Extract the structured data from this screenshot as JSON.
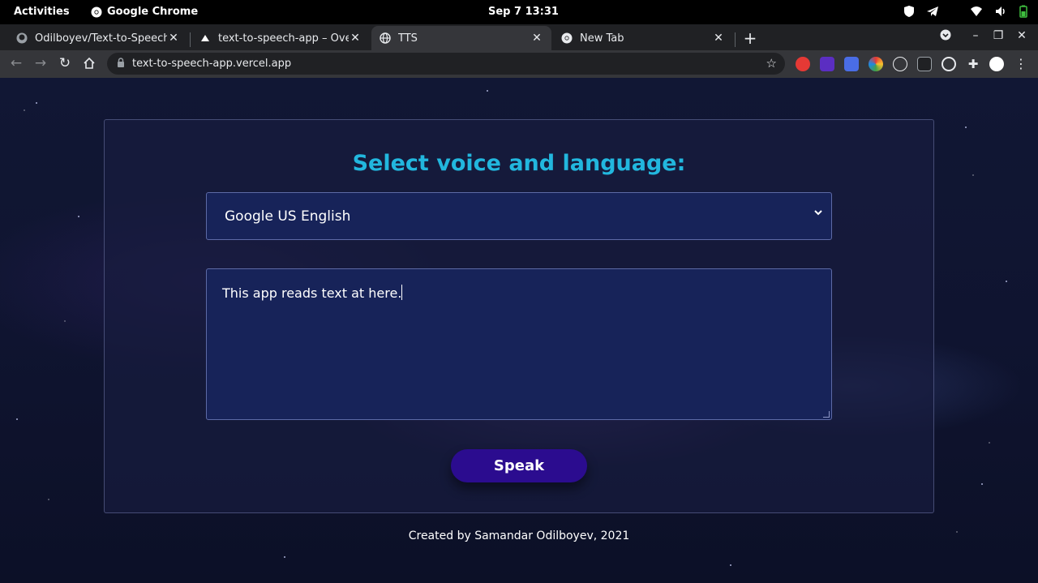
{
  "system_bar": {
    "activities": "Activities",
    "app_name": "Google Chrome",
    "clock": "Sep 7  13:31"
  },
  "tabs": [
    {
      "title": "Odilboyev/Text-to-Speech",
      "icon": "github-icon"
    },
    {
      "title": "text-to-speech-app – Overview",
      "icon": "vercel-icon"
    },
    {
      "title": "TTS",
      "icon": "globe-icon",
      "active": true
    },
    {
      "title": "New Tab",
      "icon": "chrome-icon"
    }
  ],
  "toolbar": {
    "url": "text-to-speech-app.vercel.app"
  },
  "app": {
    "heading": "Select voice and language:",
    "voice_selected": "Google US English",
    "text_value": "This app reads text at here.",
    "speak_label": "Speak",
    "footer": "Created by Samandar Odilboyev, 2021"
  },
  "colors": {
    "heading": "#22b7de",
    "button": "#2b0c8f",
    "field_bg": "#172359"
  }
}
